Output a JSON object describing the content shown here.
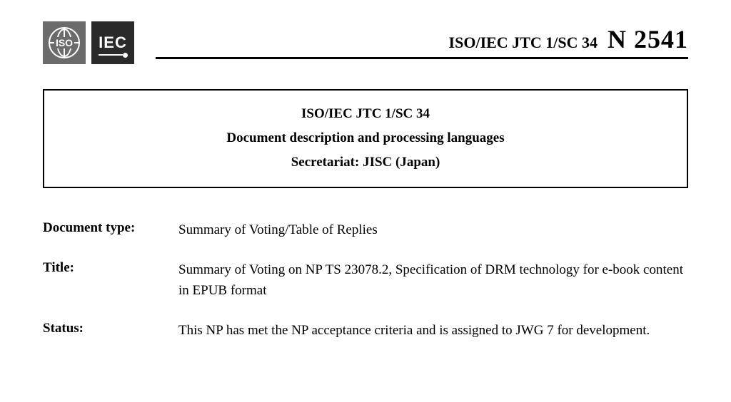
{
  "header": {
    "iso_label": "ISO",
    "iec_label": "IEC",
    "committee_id": "ISO/IEC JTC 1/SC 34",
    "doc_number": "N 2541"
  },
  "title_box": {
    "committee": "ISO/IEC JTC 1/SC 34",
    "description": "Document description and processing languages",
    "secretariat": "Secretariat: JISC (Japan)"
  },
  "metadata": {
    "doc_type_label": "Document type:",
    "doc_type_value": "Summary of Voting/Table of Replies",
    "title_label": "Title:",
    "title_value": "Summary of Voting on NP TS 23078.2, Specification of DRM technology for e-book content in EPUB format",
    "status_label": "Status:",
    "status_value": "This NP has met the NP acceptance criteria and is assigned to JWG 7 for development."
  }
}
